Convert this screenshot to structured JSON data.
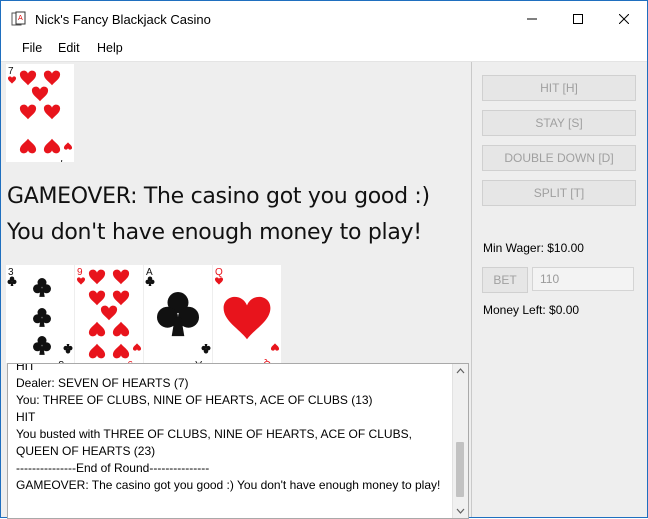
{
  "window": {
    "title": "Nick's Fancy Blackjack Casino"
  },
  "menu": [
    "File",
    "Edit",
    "Help"
  ],
  "dealer_cards": [
    {
      "rank": "7",
      "suit": "hearts"
    }
  ],
  "messages": {
    "line1": "GAMEOVER: The casino got you good :)",
    "line2": "You don't have enough money to play!"
  },
  "player_cards": [
    {
      "rank": "3",
      "suit": "clubs"
    },
    {
      "rank": "9",
      "suit": "hearts"
    },
    {
      "rank": "A",
      "suit": "clubs"
    },
    {
      "rank": "Q",
      "suit": "hearts"
    }
  ],
  "log": [
    "HIT",
    "Dealer: SEVEN OF HEARTS (7)",
    "You: THREE OF CLUBS, NINE OF HEARTS, ACE OF CLUBS (13)",
    "HIT",
    "You busted with THREE OF CLUBS, NINE OF HEARTS, ACE OF CLUBS, QUEEN OF HEARTS (23)",
    "---------------End of Round---------------",
    "GAMEOVER: The casino got you good :) You don't have enough money to play!"
  ],
  "controls": {
    "hit": "HIT [H]",
    "stay": "STAY [S]",
    "double_down": "DOUBLE DOWN [D]",
    "split": "SPLIT [T]",
    "min_wager": "Min Wager: $10.00",
    "bet": "BET",
    "bet_amount": "110",
    "money_left": "Money Left: $0.00"
  },
  "colors": {
    "heart_red": "#e8141c",
    "club_black": "#111111",
    "disabled_text": "#a0a0a0"
  }
}
